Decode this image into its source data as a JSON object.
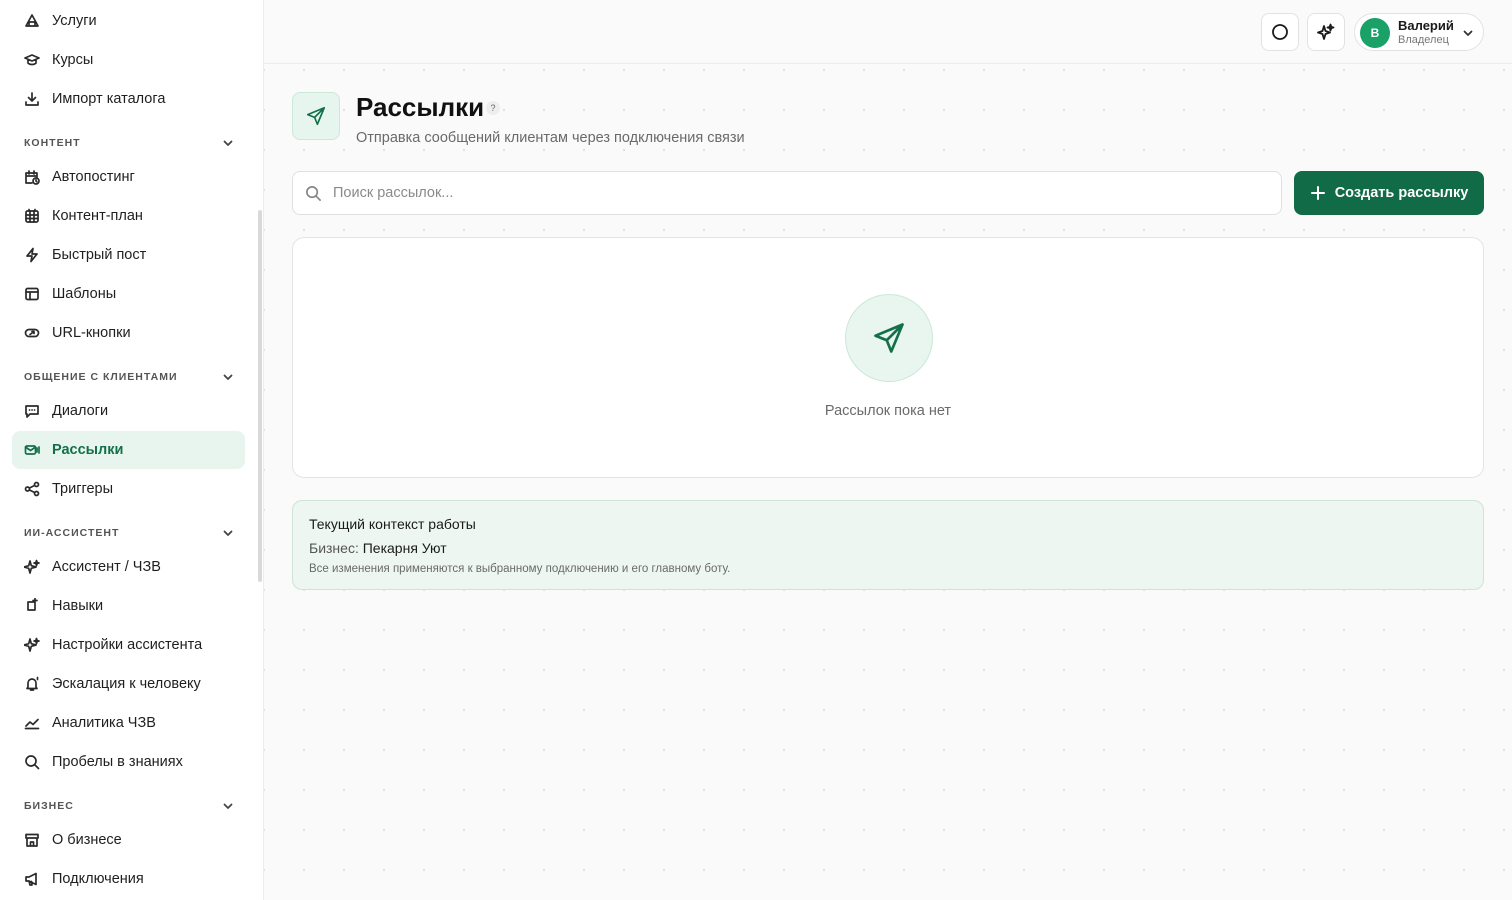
{
  "sidebar": {
    "items_top": [
      {
        "label": "Услуги",
        "icon": "services-icon"
      },
      {
        "label": "Курсы",
        "icon": "graduation-cap-icon"
      },
      {
        "label": "Импорт каталога",
        "icon": "download-icon"
      }
    ],
    "sections": [
      {
        "title": "КОНТЕНТ",
        "items": [
          {
            "label": "Автопостинг",
            "icon": "calendar-clock-icon"
          },
          {
            "label": "Контент-план",
            "icon": "grid-calendar-icon"
          },
          {
            "label": "Быстрый пост",
            "icon": "lightning-icon"
          },
          {
            "label": "Шаблоны",
            "icon": "template-icon"
          },
          {
            "label": "URL-кнопки",
            "icon": "link-button-icon"
          }
        ]
      },
      {
        "title": "ОБЩЕНИЕ С КЛИЕНТАМИ",
        "items": [
          {
            "label": "Диалоги",
            "icon": "message-icon"
          },
          {
            "label": "Рассылки",
            "icon": "mail-send-icon",
            "active": true
          },
          {
            "label": "Триггеры",
            "icon": "share-nodes-icon"
          }
        ]
      },
      {
        "title": "ИИ-АССИСТЕНТ",
        "items": [
          {
            "label": "Ассистент / ЧЗВ",
            "icon": "sparkles-icon"
          },
          {
            "label": "Навыки",
            "icon": "skill-icon"
          },
          {
            "label": "Настройки ассистента",
            "icon": "sparkles-icon"
          },
          {
            "label": "Эскалация к человеку",
            "icon": "bell-icon"
          },
          {
            "label": "Аналитика ЧЗВ",
            "icon": "trend-icon"
          },
          {
            "label": "Пробелы в знаниях",
            "icon": "search-icon"
          }
        ]
      },
      {
        "title": "БИЗНЕС",
        "items": [
          {
            "label": "О бизнесе",
            "icon": "store-icon"
          },
          {
            "label": "Подключения",
            "icon": "megaphone-icon"
          }
        ]
      }
    ]
  },
  "topbar": {
    "user_initial": "В",
    "user_name": "Валерий",
    "user_role": "Владелец"
  },
  "page": {
    "title": "Рассылки",
    "help": "?",
    "subtitle": "Отправка сообщений клиентам через подключения связи"
  },
  "search": {
    "placeholder": "Поиск рассылок...",
    "value": ""
  },
  "create_button": "Создать рассылку",
  "empty_state": "Рассылок пока нет",
  "context": {
    "title": "Текущий контекст работы",
    "business_label": "Бизнес:",
    "business_name": "Пекарня Уют",
    "note": "Все изменения применяются к выбранному подключению и его главному боту."
  },
  "colors": {
    "accent": "#116b47",
    "active_bg": "#e8f5ee",
    "avatar": "#1aa167"
  }
}
